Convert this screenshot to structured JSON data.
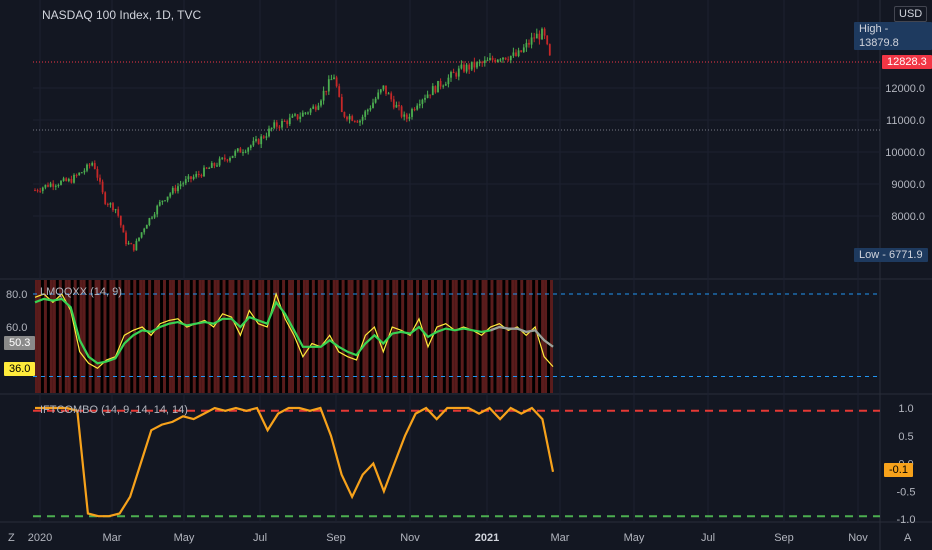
{
  "symbol": {
    "title": "NASDAQ 100 Index, 1D, TVC",
    "currency": "USD"
  },
  "price_labels": {
    "high": "High - 13879.8",
    "last": "12828.3",
    "low": "Low - 6771.9"
  },
  "indicators": {
    "laguerre": {
      "title": "LMQQXX (14, 9)",
      "value_a": "50.3",
      "value_b": "36.0"
    },
    "ift": {
      "title": "IFTCOMBO (14, 9, 14, 14, 14)",
      "value": "-0.1"
    }
  },
  "time_axis": {
    "labels": [
      "2020",
      "Mar",
      "May",
      "Jul",
      "Sep",
      "Nov",
      "2021",
      "Mar",
      "May",
      "Jul",
      "Sep",
      "Nov"
    ]
  },
  "buttons": {
    "zoom": "Z",
    "auto": "A"
  },
  "colors": {
    "bg": "#131722",
    "up": "#22ab94",
    "down": "#f23645",
    "candle_up": "#4caf50",
    "candle_down": "#c62828",
    "orange": "#f7a21b",
    "yellow": "#ffeb3b",
    "green": "#39d353",
    "gray": "#9e9e9e",
    "red_dash": "#e53935",
    "green_dash": "#4caf50",
    "blue_dash": "#2196f3",
    "label_blue": "#1e3a5f",
    "label_red": "#f23645"
  },
  "chart_data": [
    {
      "type": "candlestick",
      "title": "NASDAQ 100 Index, 1D, TVC",
      "y_ticks": [
        8000.0,
        9000.0,
        10000.0,
        11000.0,
        12000.0
      ],
      "ylim": [
        6771.9,
        13879.8
      ],
      "x_ticks": [
        "2020",
        "Mar",
        "May",
        "Jul",
        "Sep",
        "Nov",
        "2021",
        "Mar"
      ],
      "series": [
        {
          "name": "close",
          "x": [
            "2020-01-02",
            "2020-01-15",
            "2020-01-31",
            "2020-02-14",
            "2020-02-19",
            "2020-02-28",
            "2020-03-09",
            "2020-03-16",
            "2020-03-23",
            "2020-04-01",
            "2020-04-15",
            "2020-04-30",
            "2020-05-15",
            "2020-06-01",
            "2020-06-15",
            "2020-07-01",
            "2020-07-15",
            "2020-08-03",
            "2020-08-17",
            "2020-09-02",
            "2020-09-08",
            "2020-09-23",
            "2020-10-12",
            "2020-10-30",
            "2020-11-09",
            "2020-11-30",
            "2020-12-15",
            "2021-01-04",
            "2021-01-15",
            "2021-01-29",
            "2021-02-12",
            "2021-02-19",
            "2021-02-25"
          ],
          "values": [
            8800,
            9000,
            9100,
            9500,
            9700,
            8500,
            8200,
            7200,
            7000,
            7700,
            8500,
            9000,
            9300,
            9700,
            10000,
            10300,
            10800,
            11100,
            11400,
            12400,
            11200,
            11000,
            12000,
            11000,
            11600,
            12200,
            12600,
            12800,
            13000,
            13000,
            13600,
            13700,
            12828
          ]
        }
      ],
      "annotations": [
        "High - 13879.8",
        "12828.3",
        "Low - 6771.9"
      ]
    },
    {
      "type": "line",
      "title": "LMQQXX (14, 9)",
      "y_ticks": [
        60.0,
        80.0
      ],
      "levels": [
        80,
        30
      ],
      "series": [
        {
          "name": "fast",
          "values": [
            78,
            80,
            75,
            80,
            70,
            45,
            38,
            35,
            40,
            42,
            55,
            58,
            60,
            55,
            62,
            64,
            65,
            60,
            62,
            64,
            60,
            68,
            66,
            55,
            70,
            62,
            60,
            80,
            65,
            55,
            42,
            50,
            48,
            55,
            45,
            42,
            40,
            55,
            60,
            45,
            60,
            58,
            55,
            65,
            48,
            60,
            62,
            58,
            60,
            58,
            55,
            60,
            62,
            58,
            60,
            55,
            60,
            42,
            36
          ]
        },
        {
          "name": "signal",
          "values": [
            75,
            77,
            76,
            77,
            72,
            52,
            42,
            38,
            39,
            41,
            50,
            55,
            58,
            57,
            60,
            62,
            63,
            61,
            62,
            63,
            62,
            65,
            65,
            60,
            66,
            64,
            62,
            75,
            68,
            58,
            48,
            48,
            48,
            52,
            48,
            45,
            43,
            50,
            55,
            50,
            56,
            57,
            56,
            60,
            54,
            57,
            59,
            58,
            59,
            58,
            57,
            58,
            60,
            59,
            59,
            57,
            58,
            52,
            48
          ]
        }
      ]
    },
    {
      "type": "line",
      "title": "IFTCOMBO (14, 9, 14, 14, 14)",
      "y_ticks": [
        -1.0,
        -0.5,
        0.0,
        0.5,
        1.0
      ],
      "levels": [
        0.95,
        -0.95
      ],
      "series": [
        {
          "name": "IFTCOMBO",
          "values": [
            1.0,
            1.0,
            1.0,
            1.0,
            0.95,
            -0.9,
            -0.95,
            -0.95,
            -0.9,
            -0.6,
            0.0,
            0.6,
            0.7,
            0.75,
            0.85,
            0.8,
            0.9,
            1.0,
            0.95,
            1.0,
            0.95,
            1.0,
            0.6,
            0.9,
            1.0,
            1.0,
            0.95,
            1.0,
            0.5,
            -0.2,
            -0.6,
            -0.2,
            0.0,
            -0.5,
            0.0,
            0.5,
            0.9,
            1.0,
            0.8,
            1.0,
            1.0,
            1.0,
            0.9,
            1.0,
            0.8,
            1.0,
            0.9,
            1.0,
            0.8,
            -0.15
          ]
        }
      ]
    }
  ]
}
